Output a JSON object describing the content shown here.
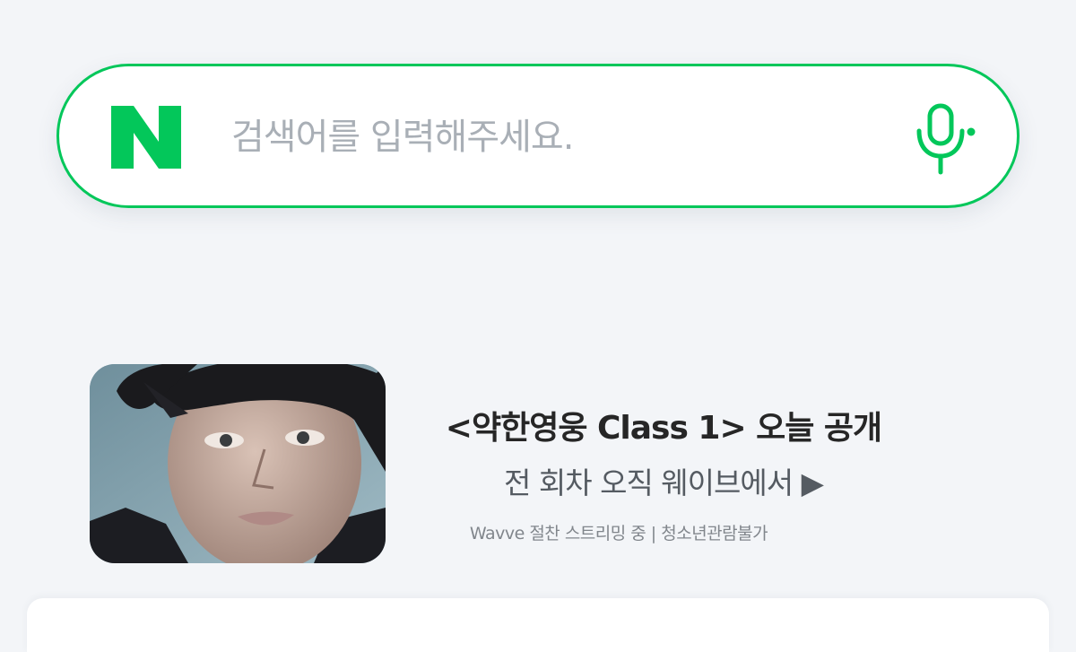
{
  "search": {
    "placeholder": "검색어를 입력해주세요."
  },
  "brand": {
    "logo_letter": "N",
    "accent_color": "#03c75a"
  },
  "icons": {
    "logo": "naver-n-logo",
    "voice": "microphone-icon"
  },
  "banner": {
    "title": "<약한영웅 Class 1> 오늘 공개",
    "subtitle": "전 회차 오직 웨이브에서 ▶",
    "caption": "Wavve 절찬 스트리밍 중 | 청소년관람불가"
  }
}
